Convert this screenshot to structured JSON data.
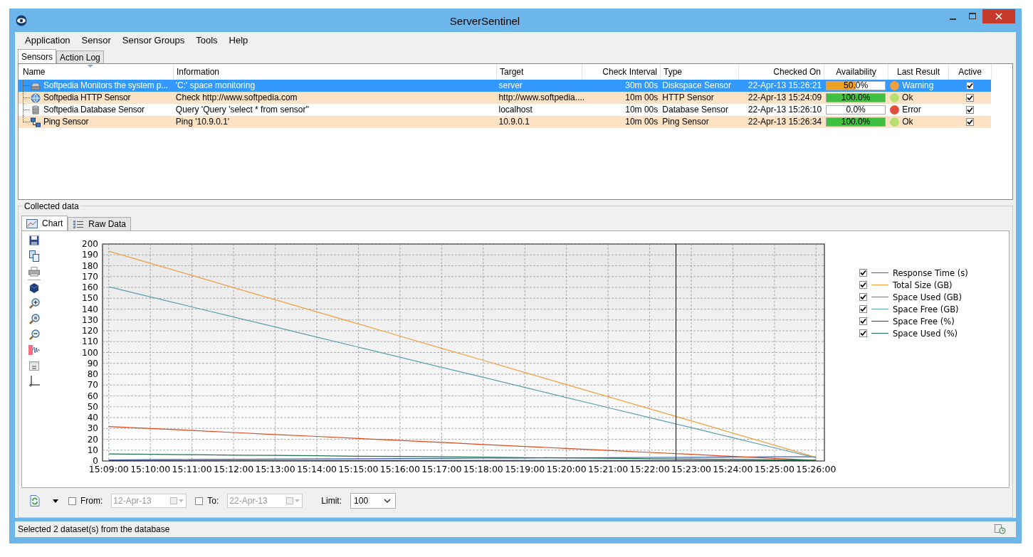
{
  "window": {
    "title": "ServerSentinel"
  },
  "menu": [
    "Application",
    "Sensor",
    "Sensor Groups",
    "Tools",
    "Help"
  ],
  "tabs": [
    {
      "label": "Sensors",
      "selected": true
    },
    {
      "label": "Action Log",
      "selected": false
    }
  ],
  "sensors": {
    "columns": [
      "Name",
      "Information",
      "Target",
      "Check Interval",
      "Type",
      "Checked On",
      "Availability",
      "Last Result",
      "Active"
    ],
    "rows": [
      {
        "kind": "drive",
        "name": "Softpedia Monitors the system p...",
        "information": "'C:' space monitoring",
        "target": "server",
        "interval": "30m 00s",
        "type": "Diskspace Sensor",
        "checked_on": "22-Apr-13 15:26:21",
        "availability": "50.0%",
        "level": 0.5,
        "color": "#f0a040",
        "result": "Warning",
        "active": true,
        "selected": true
      },
      {
        "kind": "globe",
        "name": "Softpedia HTTP Sensor",
        "information": "Check http://www.softpedia.com",
        "target": "http://www.softpedia....",
        "interval": "10m 00s",
        "type": "HTTP Sensor",
        "checked_on": "22-Apr-13 15:24:09",
        "availability": "100.0%",
        "level": 1,
        "color": "#b8e070",
        "result": "Ok",
        "active": true,
        "selected": false
      },
      {
        "kind": "database",
        "name": "Softpedia Database Sensor",
        "information": "Query 'Query 'select * from sensor''",
        "target": "localhost",
        "interval": "10m 00s",
        "type": "Database Sensor",
        "checked_on": "22-Apr-13 15:26:10",
        "availability": "0.0%",
        "level": 0,
        "color": "#e05040",
        "result": "Error",
        "active": true,
        "selected": false
      },
      {
        "kind": "network",
        "name": "Ping Sensor",
        "information": "Ping '10.9.0.1'",
        "target": "10.9.0.1",
        "interval": "10m 00s",
        "type": "Ping Sensor",
        "checked_on": "22-Apr-13 15:26:34",
        "availability": "100.0%",
        "level": 1,
        "color": "#b8e070",
        "result": "Ok",
        "active": true,
        "selected": false
      }
    ]
  },
  "collected": {
    "title": "Collected data",
    "tabs": [
      {
        "label": "Chart",
        "selected": true
      },
      {
        "label": "Raw Data",
        "selected": false
      }
    ],
    "chart_data": {
      "type": "line",
      "categories": [
        "15:09:00",
        "15:10:00",
        "15:11:00",
        "15:12:00",
        "15:13:00",
        "15:14:00",
        "15:15:00",
        "15:16:00",
        "15:17:00",
        "15:18:00",
        "15:19:00",
        "15:20:00",
        "15:21:00",
        "15:22:00",
        "15:23:00",
        "15:24:00",
        "15:25:00",
        "15:26:00"
      ],
      "ylim": [
        0,
        200
      ],
      "grid": true,
      "yticks": [
        0,
        10,
        20,
        30,
        40,
        50,
        60,
        70,
        80,
        90,
        100,
        110,
        120,
        130,
        140,
        150,
        160,
        170,
        180,
        190,
        200
      ],
      "series": [
        {
          "name": "Response Time (s)",
          "color": "#4060a8",
          "values": [
            1.0,
            1.2,
            1.4,
            1.5,
            1.7,
            1.9,
            2.0,
            2.2,
            2.4,
            2.6,
            2.7,
            2.9,
            3.1,
            3.3,
            3.4,
            3.6,
            3.8,
            3.9
          ]
        },
        {
          "name": "Total Size (GB)",
          "color": "#f0a040",
          "values": [
            193.3,
            182.2,
            171.0,
            159.8,
            148.6,
            137.5,
            126.3,
            115.1,
            103.9,
            92.8,
            81.6,
            70.4,
            59.2,
            48.1,
            36.9,
            25.7,
            14.5,
            3.4
          ]
        },
        {
          "name": "Space Used (GB)",
          "color": "#e04818",
          "values": [
            31.7,
            29.9,
            28.1,
            26.2,
            24.4,
            22.6,
            20.7,
            18.9,
            17.1,
            15.2,
            13.4,
            11.6,
            9.7,
            7.9,
            6.1,
            4.2,
            2.4,
            0.6
          ]
        },
        {
          "name": "Space Free (GB)",
          "color": "#5aa0b0",
          "values": [
            160.6,
            151.3,
            142.0,
            132.7,
            123.5,
            114.2,
            104.9,
            95.6,
            86.3,
            77.1,
            67.8,
            58.5,
            49.2,
            39.9,
            30.7,
            21.4,
            12.1,
            2.8
          ]
        },
        {
          "name": "Space Free (%)",
          "color": "#283878",
          "values": [
            0.4,
            0.4,
            0.4,
            0.4,
            0.4,
            0.4,
            0.4,
            0.4,
            0.4,
            0.4,
            0.4,
            0.4,
            0.4,
            0.4,
            0.4,
            0.4,
            0.4,
            0.4
          ]
        },
        {
          "name": "Space Used (%)",
          "color": "#207050",
          "values": [
            6.4,
            6.1,
            5.8,
            5.4,
            5.1,
            4.8,
            4.4,
            4.1,
            3.8,
            3.5,
            3.1,
            2.8,
            2.5,
            2.1,
            1.8,
            1.5,
            1.1,
            0.8
          ]
        }
      ]
    },
    "legend": [
      {
        "checked": true
      },
      {
        "checked": true
      },
      {
        "checked": true
      },
      {
        "checked": true
      },
      {
        "checked": true
      },
      {
        "checked": true
      }
    ],
    "from": {
      "label": "From:",
      "checked": false,
      "value": "12-Apr-13"
    },
    "to": {
      "label": "To:",
      "checked": false,
      "value": "22-Apr-13"
    },
    "limit": {
      "label": "Limit:",
      "value": "100"
    }
  },
  "status_bar": "Selected 2 dataset(s) from the database"
}
